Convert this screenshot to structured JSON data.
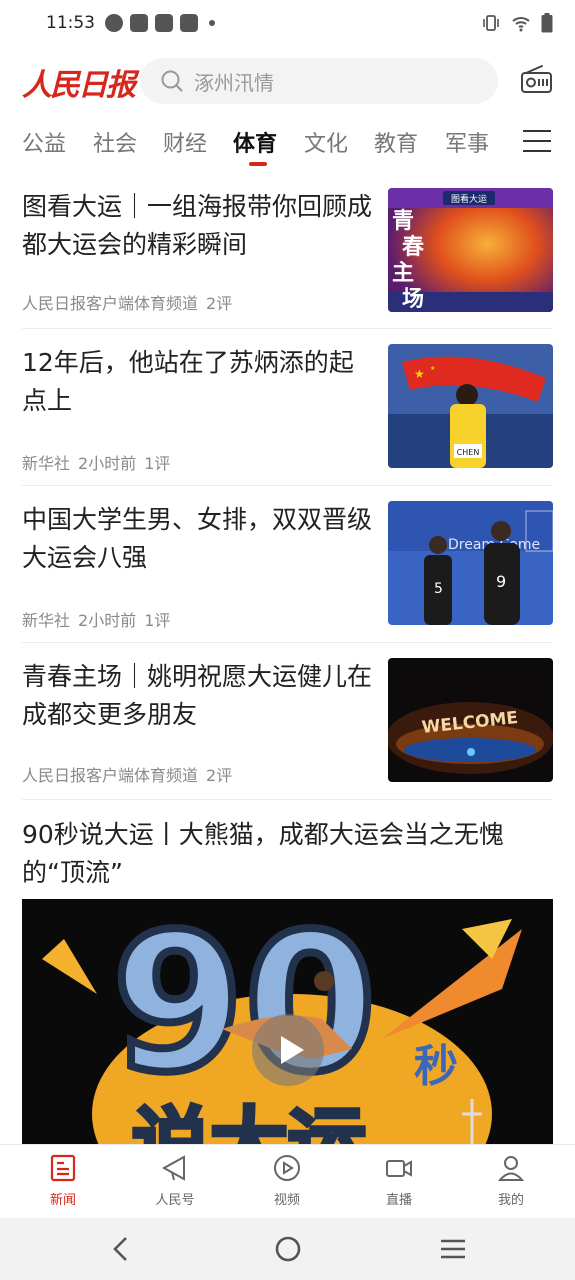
{
  "status_bar": {
    "time": "11:53",
    "notification_icons": [
      "app-icon",
      "bag-icon",
      "bag-icon",
      "bag-icon"
    ],
    "right_icons": [
      "vibrate-icon",
      "wifi-icon",
      "battery-icon"
    ]
  },
  "header": {
    "logo_text": "人民日报",
    "search_placeholder": "涿州汛情",
    "brand_color": "#d7261b"
  },
  "tabs": {
    "items": [
      "公益",
      "社会",
      "财经",
      "体育",
      "文化",
      "教育",
      "军事"
    ],
    "active": "体育"
  },
  "articles": [
    {
      "title": "图看大运｜一组海报带你回顾成都大运会的精彩瞬间",
      "source": "人民日报客户端体育频道",
      "time": "",
      "comments": "2评",
      "thumb_text": "青春主场",
      "thumb_banner": "图看大运"
    },
    {
      "title": "12年后，他站在了苏炳添的起点上",
      "source": "新华社",
      "time": "2小时前",
      "comments": "1评",
      "thumb_text": "CHEN"
    },
    {
      "title": "中国大学生男、女排，双双晋级大运会八强",
      "source": "新华社",
      "time": "2小时前",
      "comments": "1评",
      "thumb_text": "Dream Come"
    },
    {
      "title": "青春主场｜姚明祝愿大运健儿在成都交更多朋友",
      "source": "人民日报客户端体育频道",
      "time": "",
      "comments": "2评",
      "thumb_text": "WELCOME"
    }
  ],
  "video_article": {
    "title": "90秒说大运丨大熊猫，成都大运会当之无愧的“顶流”",
    "cover_number": "90",
    "cover_suffix": "秒",
    "cover_bottom": "说大运"
  },
  "bottom_nav": {
    "items": [
      {
        "label": "新闻",
        "icon": "news-icon",
        "active": true
      },
      {
        "label": "人民号",
        "icon": "megaphone-icon",
        "active": false
      },
      {
        "label": "视频",
        "icon": "video-play-icon",
        "active": false
      },
      {
        "label": "直播",
        "icon": "live-camera-icon",
        "active": false
      },
      {
        "label": "我的",
        "icon": "profile-icon",
        "active": false
      }
    ]
  }
}
